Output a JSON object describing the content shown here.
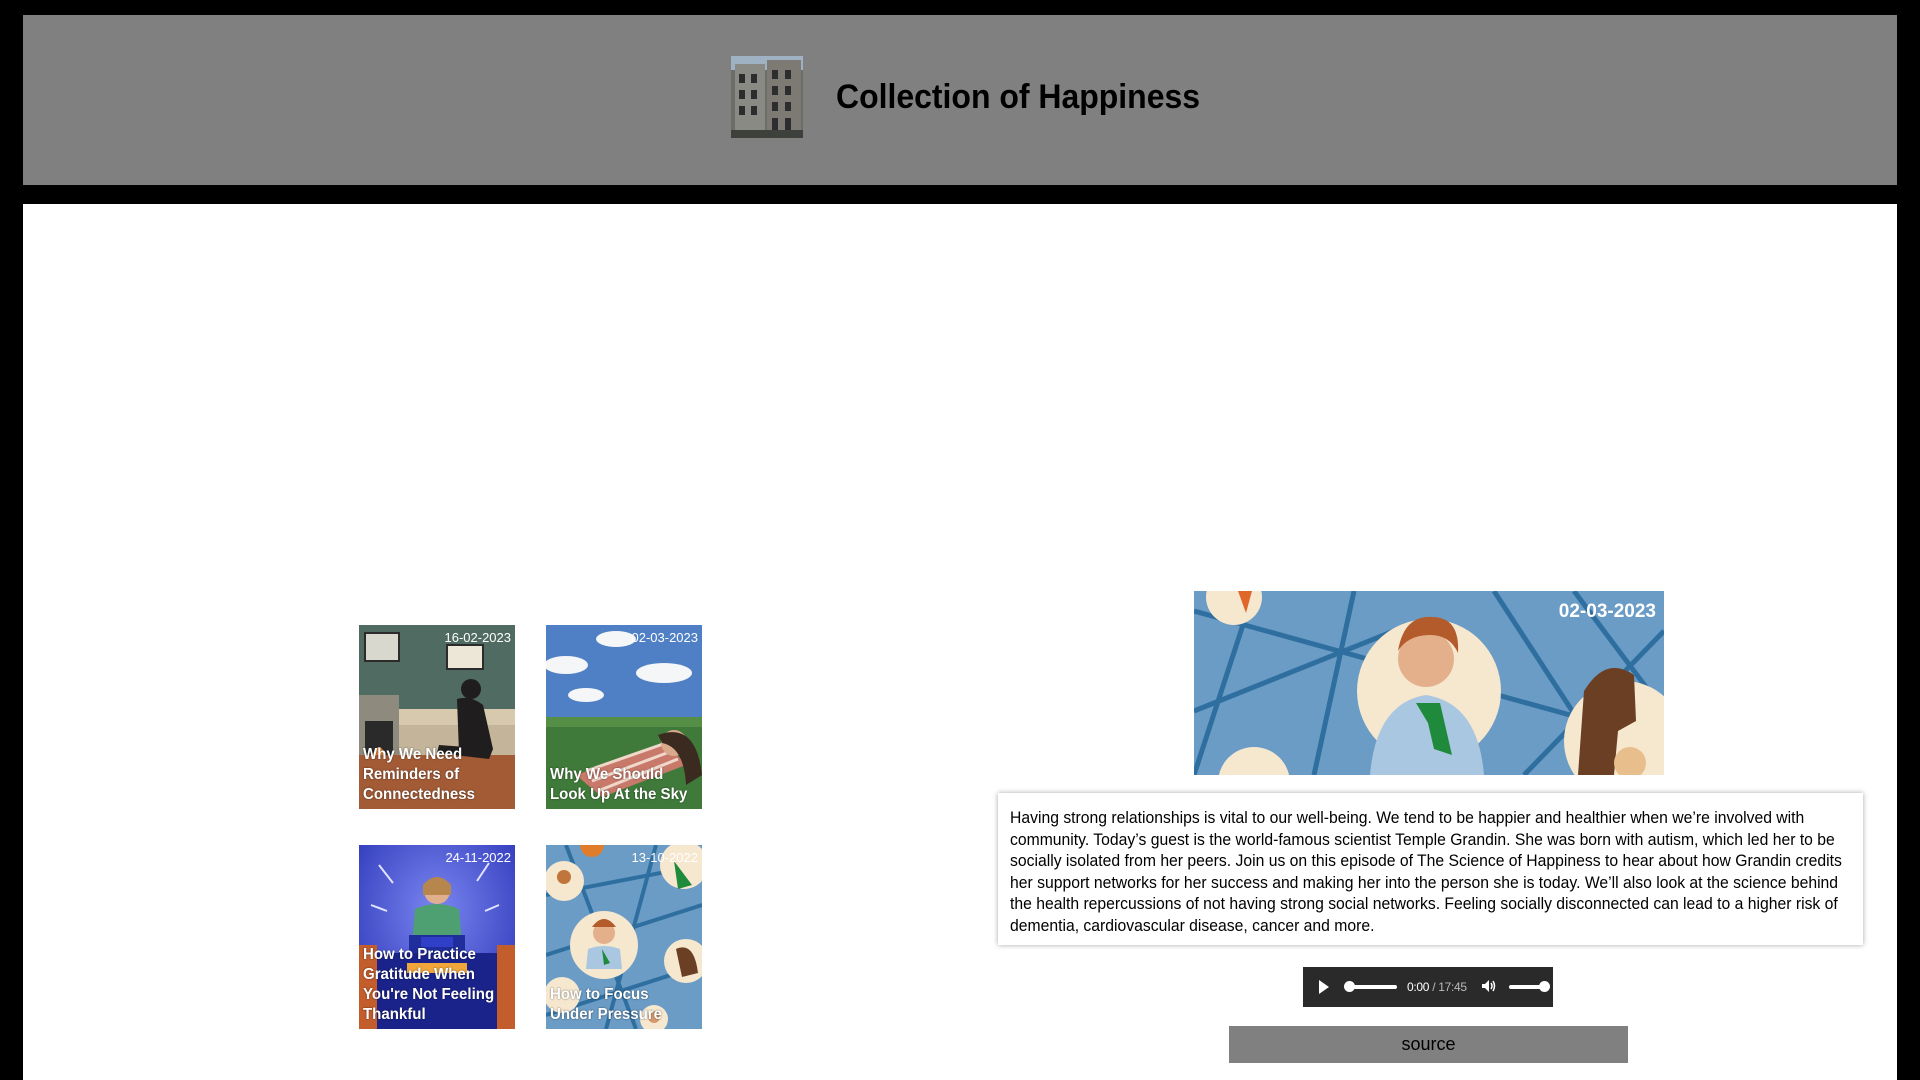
{
  "header": {
    "title": "Collection of Happiness"
  },
  "cards": [
    {
      "date": "16-02-2023",
      "title": "Why We Need Reminders of Connectedness"
    },
    {
      "date": "02-03-2023",
      "title": "Why We Should Look Up At the Sky"
    },
    {
      "date": "24-11-2022",
      "title": "How to Practice Gratitude When You're Not Feeling Thankful"
    },
    {
      "date": "13-10-2022",
      "title": "How to Focus Under Pressure"
    }
  ],
  "feature": {
    "date": "02-03-2023",
    "description": "Having strong relationships is vital to our well-being. We tend to be happier and healthier when we’re involved with community. Today’s guest is the world-famous scientist Temple Grandin. She was born with autism, which led her to be socially isolated from her peers. Join us on this episode of The Science of Happiness to hear about how Grandin credits her support networks for her success and making her into the person she is today. We’ll also look at the science behind the health repercussions of not having strong social networks. Feeling socially disconnected can lead to a higher risk of dementia, cardiovascular disease, cancer and more.",
    "audio": {
      "current_time": "0:00",
      "separator": " / ",
      "duration": "17:45",
      "progress": 0
    },
    "source_label": "source"
  },
  "icons": {
    "play": "play-icon",
    "volume": "volume-icon"
  },
  "colors": {
    "header_bg": "#808080",
    "page_bg": "#000000",
    "content_bg": "#ffffff",
    "source_bg": "#808080"
  }
}
